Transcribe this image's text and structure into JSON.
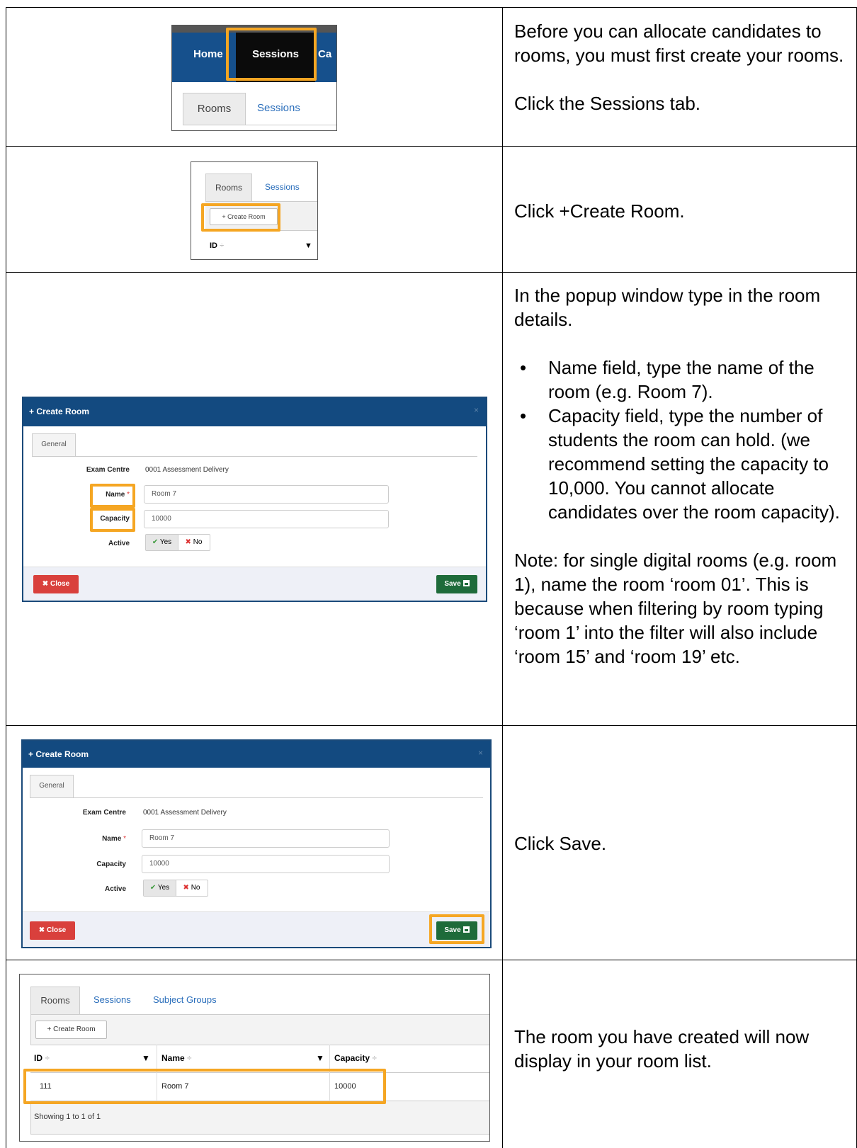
{
  "rows": [
    {
      "paragraphs": [
        "Before you can allocate candidates to rooms, you must first create your rooms.",
        "Click the Sessions tab."
      ]
    },
    {
      "paragraphs": [
        "Click +Create Room."
      ]
    },
    {
      "intro": "In the popup window type in the room details.",
      "bullets": [
        "Name field, type the name of the room (e.g. Room 7).",
        "Capacity field, type the number of students the room can hold. (we recommend setting the capacity to 10,000. You cannot allocate candidates over the room capacity)."
      ],
      "note": "Note: for single digital rooms (e.g. room 1), name the room ‘room 01’. This is because when filtering by room typing ‘room 1’ into the filter will also include ‘room 15’ and ‘room 19’ etc."
    },
    {
      "paragraphs": [
        "Click Save."
      ]
    },
    {
      "paragraphs": [
        "The room you have created will now display in your room list."
      ]
    }
  ],
  "nav": {
    "home": "Home",
    "sessions": "Sessions",
    "partial": "Ca"
  },
  "tabs": {
    "rooms": "Rooms",
    "sessions": "Sessions",
    "subject_groups": "Subject Groups"
  },
  "create_room_button": "+ Create Room",
  "modal": {
    "title": "+ Create Room",
    "close_x": "×",
    "tab_general": "General",
    "exam_centre_label": "Exam Centre",
    "exam_centre_value": "0001 Assessment Delivery",
    "name_label": "Name",
    "required_mark": "*",
    "name_value": "Room 7",
    "capacity_label": "Capacity",
    "capacity_value": "10000",
    "active_label": "Active",
    "yes": "Yes",
    "no": "No",
    "check_glyph": "✔",
    "cross_glyph": "✖",
    "close_button": "Close",
    "save_button": "Save"
  },
  "table": {
    "headers": {
      "id": "ID",
      "name": "Name",
      "capacity": "Capacity"
    },
    "sort_glyph": "÷",
    "filter_glyph": "▼",
    "row": {
      "id": "111",
      "name": "Room 7",
      "capacity": "10000"
    },
    "footer": "Showing 1 to 1 of 1"
  },
  "colors": {
    "highlight": "#F5A623",
    "nav_blue": "#16508C",
    "modal_header": "#134a80",
    "save_green": "#1e6b3a",
    "close_red": "#d9403c"
  }
}
